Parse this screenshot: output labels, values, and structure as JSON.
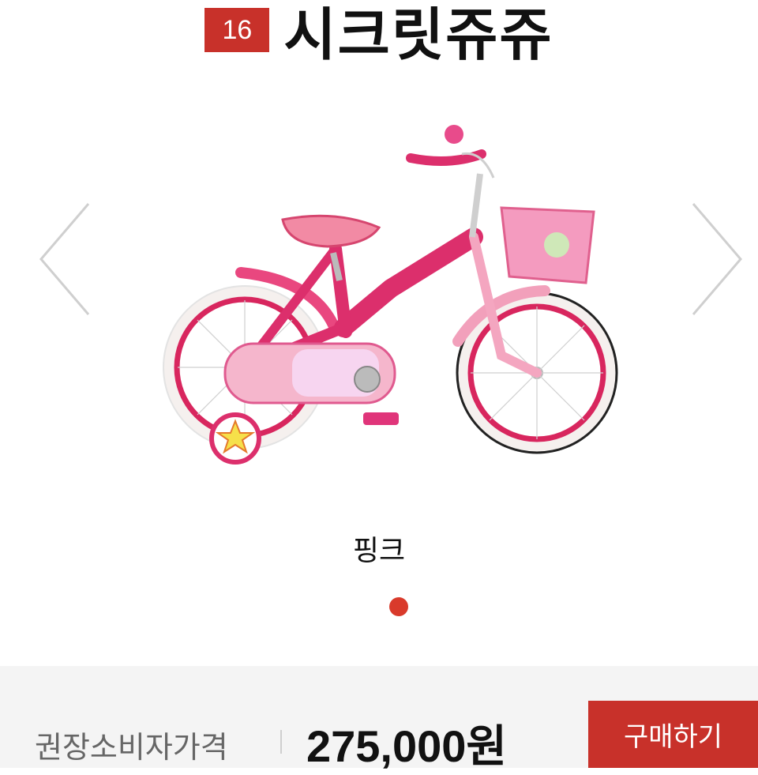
{
  "header": {
    "size_badge": "16",
    "title": "시크릿쥬쥬"
  },
  "product": {
    "color_name": "핑크",
    "color_options": [
      "#d93a2b"
    ]
  },
  "price": {
    "label": "권장소비자가격",
    "value": "275,000원"
  },
  "actions": {
    "buy_label": "구매하기"
  },
  "icons": {
    "prev": "chevron-left-icon",
    "next": "chevron-right-icon"
  },
  "colors": {
    "accent": "#c8312a",
    "bike_pink": "#e0306e",
    "basket_pink": "#f08ab0"
  }
}
